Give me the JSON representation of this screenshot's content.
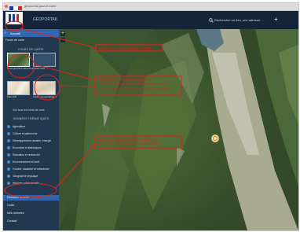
{
  "browser": {
    "url": "geoportail.gouv.fr/carte"
  },
  "header": {
    "brand": "GÉOPORTAIL",
    "search_placeholder": "Rechercher un lieu, une adresse…",
    "add_label": "+"
  },
  "panel": {
    "title": "Accueil",
    "subtitle": "Fonds de carte",
    "section_title": "FONDS DE CARTE",
    "basemaps": [
      {
        "label": "Photographies aériennes"
      },
      {
        "label": "Cartes IGN"
      },
      {
        "label": "Plan IGN"
      },
      {
        "label": "Cartes topographiques"
      }
    ],
    "more_basemaps": "Voir tous les fonds de carte",
    "thematic_title": "DONNÉES THÉMATIQUES",
    "layers": [
      "Agriculture",
      "Culture et patrimoine",
      "Développement durable, énergie",
      "Économie et statistiques",
      "Éducation et recherche",
      "Environnement et forêt",
      "Foncier, cadastre et urbanisme",
      "Géographie physique",
      "Services administratifs"
    ],
    "bottom": [
      "Découvrir la carte",
      "Outils",
      "Mes données",
      "Contact"
    ]
  },
  "annotations": {
    "a1": "ACCES AUX FONDS DE CARTE",
    "a2": [
      "FONDS DE CARTE PRINCIPAUX",
      " : vue aérienne pour identifier l'environnement",
      " : plan IGN pour afficher les types/n° de route"
    ],
    "a3": [
      "Accès aux fonds de carte avancés (en",
      "particulier : PR, limites administratives)"
    ],
    "color": "#e0221b"
  },
  "colors": {
    "topbar": "#152539",
    "panel": "#22384f",
    "accent": "#3268b0"
  }
}
